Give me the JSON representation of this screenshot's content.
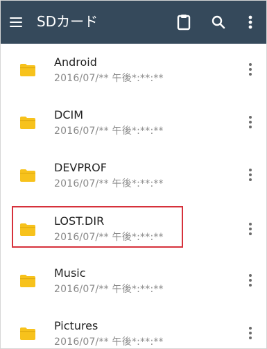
{
  "appbar": {
    "title": "SDカード",
    "icons": [
      "menu-icon",
      "clipboard-icon",
      "search-icon",
      "more-vert-icon"
    ],
    "background": "#35495b"
  },
  "folders": [
    {
      "name": "Android",
      "date": "2016/07/** 午後*:**:**"
    },
    {
      "name": "DCIM",
      "date": "2016/07/** 午後*:**:**"
    },
    {
      "name": "DEVPROF",
      "date": "2016/07/** 午後*:**:**"
    },
    {
      "name": "LOST.DIR",
      "date": "2016/07/** 午後*:**:**"
    },
    {
      "name": "Music",
      "date": "2016/07/** 午後*:**:**"
    },
    {
      "name": "Pictures",
      "date": "2016/07/** 午後*:**:**"
    }
  ],
  "colors": {
    "folder": "#f7c21c",
    "highlight_border": "#d6313b"
  },
  "highlighted_item": "LOST.DIR"
}
